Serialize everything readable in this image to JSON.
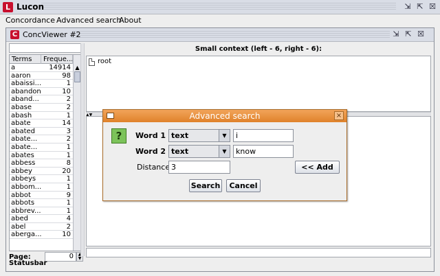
{
  "app": {
    "title": "Lucon",
    "icon_letter": "L",
    "buttons": {
      "minimize": "⇲",
      "maximize": "⇱",
      "close": "☒"
    }
  },
  "menubar": {
    "items": [
      "Concordance",
      "Advanced search",
      "About"
    ]
  },
  "inner_window": {
    "title": "ConcViewer #2",
    "icon_letter": "C"
  },
  "terms_table": {
    "columns": [
      "Terms",
      "Freque..."
    ],
    "rows": [
      {
        "term": "a",
        "freq": "14914"
      },
      {
        "term": "aaron",
        "freq": "98"
      },
      {
        "term": "abaissi...",
        "freq": "1"
      },
      {
        "term": "abandon",
        "freq": "10"
      },
      {
        "term": "aband...",
        "freq": "2"
      },
      {
        "term": "abase",
        "freq": "2"
      },
      {
        "term": "abash",
        "freq": "1"
      },
      {
        "term": "abate",
        "freq": "14"
      },
      {
        "term": "abated",
        "freq": "3"
      },
      {
        "term": "abate...",
        "freq": "2"
      },
      {
        "term": "abate...",
        "freq": "1"
      },
      {
        "term": "abates",
        "freq": "1"
      },
      {
        "term": "abbess",
        "freq": "8"
      },
      {
        "term": "abbey",
        "freq": "20"
      },
      {
        "term": "abbeys",
        "freq": "1"
      },
      {
        "term": "abbom...",
        "freq": "1"
      },
      {
        "term": "abbot",
        "freq": "9"
      },
      {
        "term": "abbots",
        "freq": "1"
      },
      {
        "term": "abbrev...",
        "freq": "1"
      },
      {
        "term": "abed",
        "freq": "4"
      },
      {
        "term": "abel",
        "freq": "2"
      },
      {
        "term": "aberga...",
        "freq": "10"
      }
    ]
  },
  "page": {
    "label": "Page:",
    "value": "0"
  },
  "context": {
    "header": "Small context (left - 6, right - 6):",
    "tree_root": "root"
  },
  "statusbar": "Statusbar",
  "dialog": {
    "title": "Advanced search",
    "help_glyph": "?",
    "word1_label": "Word 1",
    "word1_type": "text",
    "word1_value": "i",
    "word2_label": "Word 2",
    "word2_type": "text",
    "word2_value": "know",
    "distance_label": "Distance:",
    "distance_value": "3",
    "add_label": "<< Add",
    "search_label": "Search",
    "cancel_label": "Cancel",
    "close_glyph": "×"
  },
  "colors": {
    "dialog_title": "#e0822a",
    "app_icon": "#c8102e",
    "help_icon": "#7cc35a"
  }
}
